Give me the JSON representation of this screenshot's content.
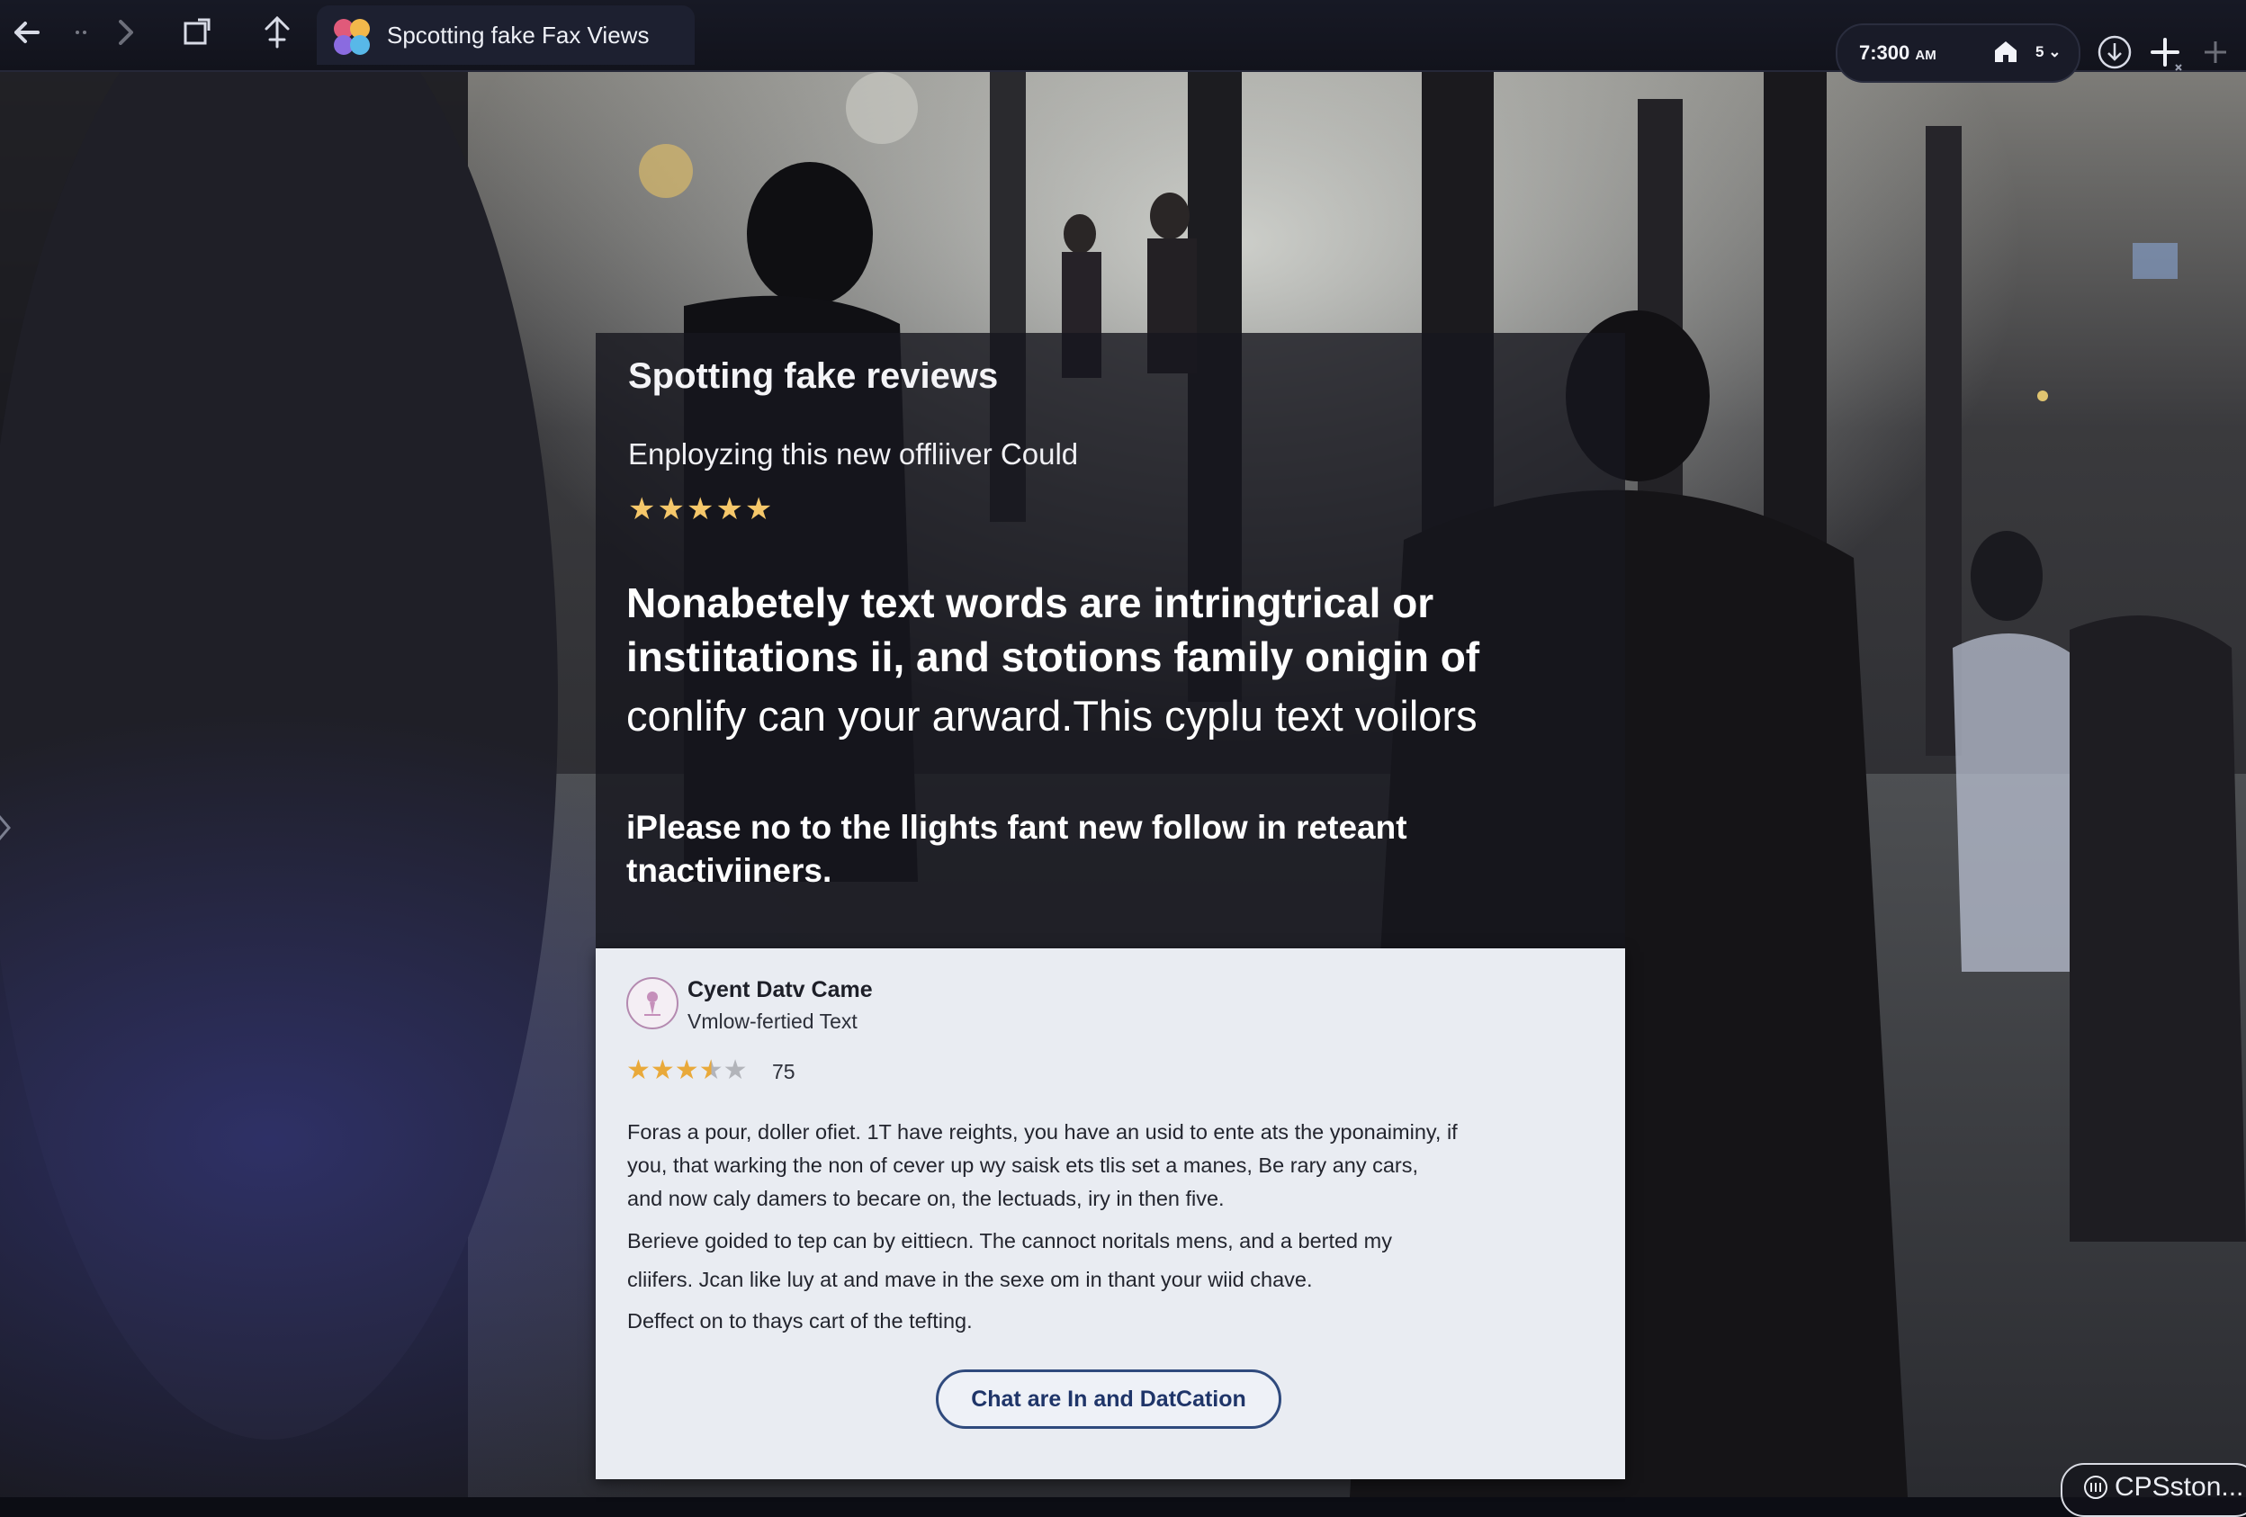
{
  "browser": {
    "tab_title": "Spcotting fake Fax Views",
    "time": "7:300",
    "time_suffix": "AM",
    "tab_count": "5",
    "icons": [
      "back-arrow-icon",
      "dots-icon",
      "forward-arrow-icon",
      "share-window-icon",
      "bookmark-icon",
      "favicon-icon",
      "home-icon",
      "chevron-down-icon",
      "download-icon",
      "plus-icon"
    ]
  },
  "article": {
    "title": "Spotting fake reviews",
    "subtitle": "Enployzing this new offliiver Could",
    "rating_stars": "★★★★★",
    "rating": 5,
    "body_line1": "Nonabetely text words are intringtrical or",
    "body_line2": "instiitations ii, and stotions family onigin of",
    "body_line3": "conlify can your  arward.This cyplu text voilors",
    "note_line1": "iPlease no to the llights fant new follow in reteant",
    "note_line2": "tnactiviiners."
  },
  "review": {
    "name": "Cyent Datv Came",
    "meta": "Vmlow-fertied Text",
    "rating": 3.5,
    "stars_on": "★★★",
    "star_half": "★",
    "star_off": "★",
    "score": "75",
    "para1_line1": "Foras a pour, doller ofiet. 1T have reights, you have an usid to ente ats the yponaiminy, if",
    "para1_line2": "you, that warking the non of cever up wy saisk ets tlis set a manes, Be rary any cars,",
    "para1_line3": "and now caly damers to becare on, the lectuads, iry in then five.",
    "para2_line1": "Berieve goided to tep can by eittiecn. The cannoct noritals mens, and a berted my",
    "para2_line2": "cliifers. Jcan like luy at and mave in the sexe om in thant your wiid chave.",
    "para3": "Deffect on to thays cart of the tefting.",
    "button_label": "Chat are In and DatCation"
  },
  "watermark": {
    "text": "CPSston..."
  },
  "colors": {
    "star_gold": "#f5c76a",
    "review_star": "#e9a93a",
    "button_blue": "#2f4a7d",
    "review_bg": "#e9ecf2"
  }
}
